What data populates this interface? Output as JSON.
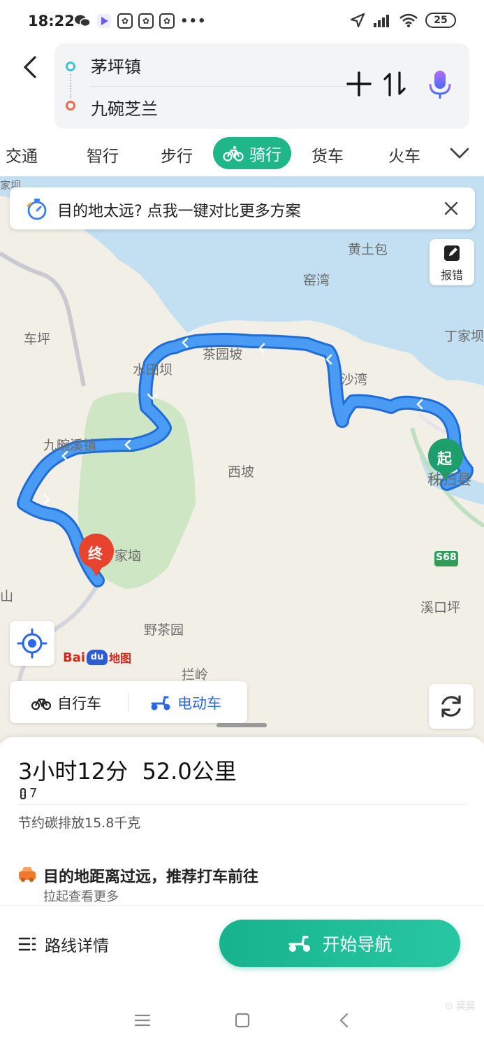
{
  "status_bar": {
    "time": "18:22",
    "battery": "25",
    "more": "•••"
  },
  "route": {
    "origin": "茅坪镇",
    "destination": "九碗芝兰"
  },
  "tabs": [
    {
      "label": "交通",
      "active": false
    },
    {
      "label": "智行",
      "active": false
    },
    {
      "label": "步行",
      "active": false
    },
    {
      "label": "骑行",
      "active": true
    },
    {
      "label": "货车",
      "active": false
    },
    {
      "label": "火车",
      "active": false
    }
  ],
  "map": {
    "banner": "目的地太远? 点我一键对比更多方案",
    "report_label": "报错",
    "start_marker": "起",
    "end_marker": "终",
    "logo_text": "Bai",
    "logo_paw": "du",
    "logo_suffix": "地图",
    "places": [
      {
        "name": "黄土包"
      },
      {
        "name": "窑湾"
      },
      {
        "name": "丁家坝"
      },
      {
        "name": "车坪"
      },
      {
        "name": "茶园坡"
      },
      {
        "name": "水田坝"
      },
      {
        "name": "沙湾"
      },
      {
        "name": "九畹溪镇"
      },
      {
        "name": "西坡"
      },
      {
        "name": "秭归县"
      },
      {
        "name": "家垴"
      },
      {
        "name": "S68"
      },
      {
        "name": "溪口坪"
      },
      {
        "name": "野茶园"
      },
      {
        "name": "拦岭"
      },
      {
        "name": "山"
      },
      {
        "name": "家坝"
      }
    ],
    "modes": [
      {
        "label": "自行车",
        "active": false
      },
      {
        "label": "电动车",
        "active": true
      }
    ]
  },
  "summary": {
    "duration": "3小时12分",
    "distance": "52.0公里",
    "traffic_lights": "7",
    "carbon": "节约碳排放15.8千克",
    "tip_title": "目的地距离过远，推荐打车前往",
    "tip_sub": "拉起查看更多"
  },
  "actions": {
    "details": "路线详情",
    "start_nav": "开始导航"
  },
  "watermark": "⊙ 莫莫",
  "colors": {
    "accent": "#1fb68a",
    "route": "#3d8ef0",
    "water": "#c3dff2",
    "park": "#cfe6c5",
    "start": "#1e9e6a",
    "end": "#e8432c"
  }
}
